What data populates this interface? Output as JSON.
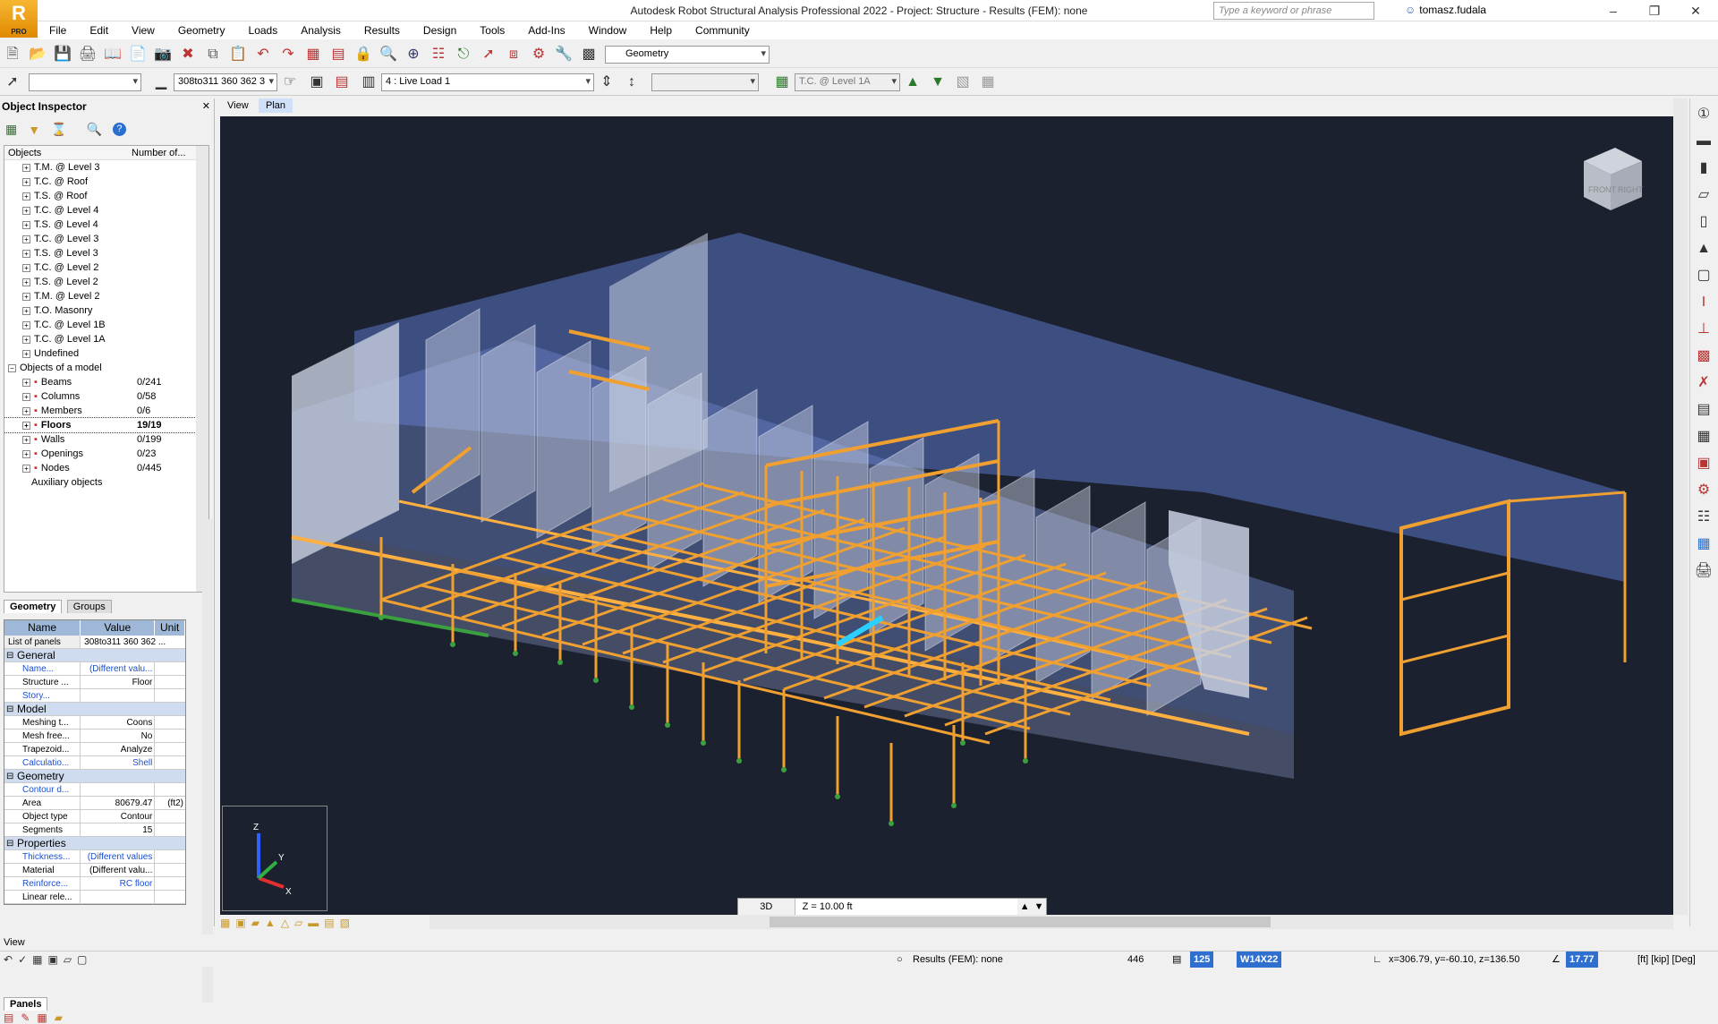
{
  "app": {
    "logo_text": "R",
    "logo_sub": "PRO",
    "title": "Autodesk Robot Structural Analysis Professional 2022 - Project: Structure - Results (FEM): none",
    "search_placeholder": "Type a keyword or phrase",
    "user": "tomasz.fudala"
  },
  "menu": [
    "File",
    "Edit",
    "View",
    "Geometry",
    "Loads",
    "Analysis",
    "Results",
    "Design",
    "Tools",
    "Add-Ins",
    "Window",
    "Help",
    "Community"
  ],
  "toolbar": {
    "layout_combo": "Geometry",
    "panel_selection": "308to311 360 362 3",
    "load_case": "4 : Live Load 1",
    "story": "T.C. @ Level 1A"
  },
  "inspector": {
    "title": "Object Inspector",
    "col_objects": "Objects",
    "col_number": "Number of...",
    "tree": [
      {
        "label": "T.M. @ Level 3",
        "count": ""
      },
      {
        "label": "T.C. @ Roof",
        "count": ""
      },
      {
        "label": "T.S. @ Roof",
        "count": ""
      },
      {
        "label": "T.C. @ Level 4",
        "count": ""
      },
      {
        "label": "T.S. @ Level 4",
        "count": ""
      },
      {
        "label": "T.C. @ Level 3",
        "count": ""
      },
      {
        "label": "T.S. @ Level 3",
        "count": ""
      },
      {
        "label": "T.C. @ Level 2",
        "count": ""
      },
      {
        "label": "T.S. @ Level 2",
        "count": ""
      },
      {
        "label": "T.M. @ Level 2",
        "count": ""
      },
      {
        "label": "T.O. Masonry",
        "count": ""
      },
      {
        "label": "T.C. @ Level 1B",
        "count": ""
      },
      {
        "label": "T.C. @ Level 1A",
        "count": ""
      },
      {
        "label": "Undefined",
        "count": ""
      }
    ],
    "model_group": "Objects of a model",
    "model_items": [
      {
        "label": "Beams",
        "count": "0/241"
      },
      {
        "label": "Columns",
        "count": "0/58"
      },
      {
        "label": "Members",
        "count": "0/6"
      },
      {
        "label": "Floors",
        "count": "19/19"
      },
      {
        "label": "Walls",
        "count": "0/199"
      },
      {
        "label": "Openings",
        "count": "0/23"
      },
      {
        "label": "Nodes",
        "count": "0/445"
      }
    ],
    "aux": "Auxiliary objects",
    "tabs": [
      "Geometry",
      "Groups"
    ],
    "prop_headers": [
      "Name",
      "Value",
      "Unit"
    ],
    "list_label": "List of panels",
    "list_value": "308to311 360 362 ...",
    "groups": [
      {
        "name": "General",
        "rows": [
          {
            "n": "Name...",
            "v": "(Different valu...",
            "u": "",
            "blue": true
          },
          {
            "n": "Structure ...",
            "v": "Floor",
            "u": "",
            "blue": false
          },
          {
            "n": "Story...",
            "v": "",
            "u": "",
            "blue": true
          }
        ]
      },
      {
        "name": "Model",
        "rows": [
          {
            "n": "Meshing t...",
            "v": "Coons",
            "u": "",
            "blue": false
          },
          {
            "n": "Mesh free...",
            "v": "No",
            "u": "",
            "blue": false
          },
          {
            "n": "Trapezoid...",
            "v": "Analyze",
            "u": "",
            "blue": false
          },
          {
            "n": "Calculatio...",
            "v": "Shell",
            "u": "",
            "blue": true
          }
        ]
      },
      {
        "name": "Geometry",
        "rows": [
          {
            "n": "Contour d...",
            "v": "",
            "u": "",
            "blue": true
          },
          {
            "n": "Area",
            "v": "80679.47",
            "u": "(ft2)",
            "blue": false
          },
          {
            "n": "Object type",
            "v": "Contour",
            "u": "",
            "blue": false
          },
          {
            "n": "Segments",
            "v": "15",
            "u": "",
            "blue": false
          }
        ]
      },
      {
        "name": "Properties",
        "rows": [
          {
            "n": "Thickness...",
            "v": "(Different values",
            "u": "",
            "blue": true
          },
          {
            "n": "Material",
            "v": "(Different valu...",
            "u": "",
            "blue": false
          },
          {
            "n": "Reinforce...",
            "v": "RC floor",
            "u": "",
            "blue": true
          },
          {
            "n": "Linear rele...",
            "v": "",
            "u": "",
            "blue": false
          }
        ]
      }
    ],
    "panels_tab": "Panels"
  },
  "viewport": {
    "tabs": [
      "View",
      "Plan"
    ],
    "mode": "3D",
    "z_level": "Z = 10.00 ft",
    "cube_front": "FRONT",
    "cube_right": "RIGHT",
    "axis_z": "Z",
    "axis_y": "Y",
    "axis_x": "X"
  },
  "viewbar": {
    "label": "View"
  },
  "statusbar": {
    "results": "Results (FEM): none",
    "nodes": "446",
    "num": "125",
    "section": "W14X22",
    "coords": "x=306.79, y=-60.10, z=136.50",
    "angle": "17.77",
    "units": "[ft] [kip] [Deg]"
  },
  "colors": {
    "wall": "#6f86c8",
    "frame": "#f0a030",
    "bg": "#1c2130"
  }
}
